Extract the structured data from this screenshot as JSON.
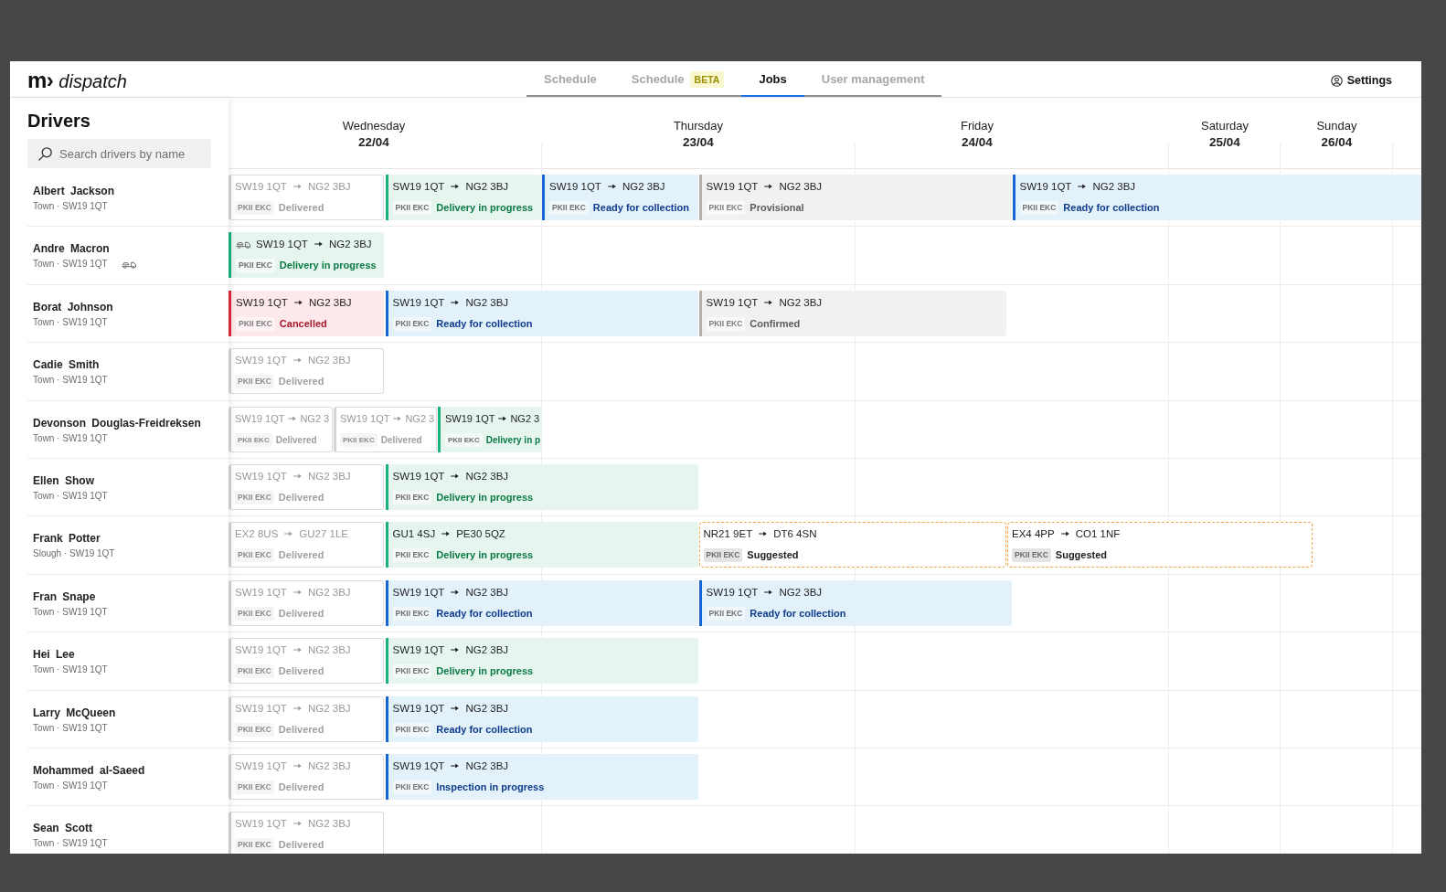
{
  "app": {
    "logo_mark": "m›",
    "logo_name": "dispatch"
  },
  "tabs": [
    {
      "label": "Schedule",
      "selected": false
    },
    {
      "label": "Schedule",
      "badge": "BETA",
      "selected": false
    },
    {
      "label": "Jobs",
      "selected": true
    },
    {
      "label": "User management",
      "selected": false
    }
  ],
  "settings": {
    "label": "Settings"
  },
  "sidebar": {
    "title": "Drivers",
    "search": {
      "placeholder": "Search drivers by name"
    }
  },
  "days": [
    {
      "name": "Wednesday",
      "date": "22/04"
    },
    {
      "name": "Thursday",
      "date": "23/04"
    },
    {
      "name": "Friday",
      "date": "24/04"
    },
    {
      "name": "Saturday",
      "date": "25/04"
    },
    {
      "name": "Sunday",
      "date": "26/04"
    }
  ],
  "drivers": [
    {
      "name": "Albert Jackson",
      "subtitle": "Town · SW19 1QT",
      "marker": false,
      "jobs": [
        {
          "from": "SW19 1QT",
          "to": "NG2 3BJ",
          "reg": "PKII EKC",
          "status": "Delivered",
          "kind": "delivered",
          "marker": false
        },
        {
          "from": "SW19 1QT",
          "to": "NG2 3BJ",
          "reg": "PKII EKC",
          "status": "Delivery in progress",
          "kind": "delivering",
          "marker": false
        },
        {
          "from": "SW19 1QT",
          "to": "NG2 3BJ",
          "reg": "PKII EKC",
          "status": "Ready for collection",
          "kind": "ready",
          "marker": false
        },
        {
          "from": "SW19 1QT",
          "to": "NG2 3BJ",
          "reg": "PKII EKC",
          "status": "Provisional",
          "kind": "provisional",
          "marker": false
        },
        {
          "from": "SW19 1QT",
          "to": "NG2 3BJ",
          "reg": "PKII EKC",
          "status": "Ready for collection",
          "kind": "ready",
          "marker": false
        }
      ]
    },
    {
      "name": "Andre Macron",
      "subtitle": "Town · SW19 1QT",
      "marker": true,
      "jobs": [
        {
          "from": "SW19 1QT",
          "to": "NG2 3BJ",
          "reg": "PKII EKC",
          "status": "Delivery in progress",
          "kind": "delivering",
          "marker": true
        }
      ]
    },
    {
      "name": "Borat Johnson",
      "subtitle": "Town · SW19 1QT",
      "marker": false,
      "jobs": [
        {
          "from": "SW19 1QT",
          "to": "NG2 3BJ",
          "reg": "PKII EKC",
          "status": "Cancelled",
          "kind": "cancelled",
          "marker": false
        },
        {
          "from": "SW19 1QT",
          "to": "NG2 3BJ",
          "reg": "PKII EKC",
          "status": "Ready for collection",
          "kind": "ready",
          "marker": false
        },
        {
          "from": "SW19 1QT",
          "to": "NG2 3BJ",
          "reg": "PKII EKC",
          "status": "Confirmed",
          "kind": "confirmed",
          "marker": false
        }
      ]
    },
    {
      "name": "Cadie Smith",
      "subtitle": "Town · SW19 1QT",
      "marker": false,
      "jobs": [
        {
          "from": "SW19 1QT",
          "to": "NG2 3BJ",
          "reg": "PKII EKC",
          "status": "Delivered",
          "kind": "delivered",
          "marker": false
        }
      ]
    },
    {
      "name": "Devonson Douglas-Freidreksen",
      "subtitle": "Town · SW19 1QT",
      "marker": false,
      "jobs": [
        {
          "from": "SW19 1QT",
          "to": "NG2 3",
          "reg": "PKII EKC",
          "status": "Delivered",
          "kind": "delivered",
          "marker": false
        },
        {
          "from": "SW19 1QT",
          "to": "NG2 3",
          "reg": "PKII EKC",
          "status": "Delivered",
          "kind": "delivered",
          "marker": false
        },
        {
          "from": "SW19 1QT",
          "to": "NG2 3",
          "reg": "PKII EKC",
          "status": "Delivery in p",
          "kind": "delivering",
          "marker": false
        }
      ]
    },
    {
      "name": "Ellen Show",
      "subtitle": "Town · SW19 1QT",
      "marker": false,
      "jobs": [
        {
          "from": "SW19 1QT",
          "to": "NG2 3BJ",
          "reg": "PKII EKC",
          "status": "Delivered",
          "kind": "delivered",
          "marker": false
        },
        {
          "from": "SW19 1QT",
          "to": "NG2 3BJ",
          "reg": "PKII EKC",
          "status": "Delivery in progress",
          "kind": "delivering",
          "marker": false
        }
      ]
    },
    {
      "name": "Frank Potter",
      "subtitle": "Slough · SW19 1QT",
      "marker": false,
      "jobs": [
        {
          "from": "EX2 8US",
          "to": "GU27 1LE",
          "reg": "PKII EKC",
          "status": "Delivered",
          "kind": "delivered",
          "marker": false
        },
        {
          "from": "GU1 4SJ",
          "to": "PE30 5QZ",
          "reg": "PKII EKC",
          "status": "Delivery in progress",
          "kind": "delivering",
          "marker": false
        },
        {
          "from": "NR21 9ET",
          "to": "DT6 4SN",
          "reg": "PKII EKC",
          "status": "Suggested",
          "kind": "suggested",
          "marker": false
        },
        {
          "from": "EX4 4PP",
          "to": "CO1 1NF",
          "reg": "PKII EKC",
          "status": "Suggested",
          "kind": "suggested",
          "marker": false
        }
      ]
    },
    {
      "name": "Fran Snape",
      "subtitle": "Town · SW19 1QT",
      "marker": false,
      "jobs": [
        {
          "from": "SW19 1QT",
          "to": "NG2 3BJ",
          "reg": "PKII EKC",
          "status": "Delivered",
          "kind": "delivered",
          "marker": false
        },
        {
          "from": "SW19 1QT",
          "to": "NG2 3BJ",
          "reg": "PKII EKC",
          "status": "Ready for collection",
          "kind": "ready",
          "marker": false
        },
        {
          "from": "SW19 1QT",
          "to": "NG2 3BJ",
          "reg": "PKII EKC",
          "status": "Ready for collection",
          "kind": "ready",
          "marker": false
        }
      ]
    },
    {
      "name": "Hei Lee",
      "subtitle": "Town · SW19 1QT",
      "marker": false,
      "jobs": [
        {
          "from": "SW19 1QT",
          "to": "NG2 3BJ",
          "reg": "PKII EKC",
          "status": "Delivered",
          "kind": "delivered",
          "marker": false
        },
        {
          "from": "SW19 1QT",
          "to": "NG2 3BJ",
          "reg": "PKII EKC",
          "status": "Delivery in progress",
          "kind": "delivering",
          "marker": false
        }
      ]
    },
    {
      "name": "Larry McQueen",
      "subtitle": "Town · SW19 1QT",
      "marker": false,
      "jobs": [
        {
          "from": "SW19 1QT",
          "to": "NG2 3BJ",
          "reg": "PKII EKC",
          "status": "Delivered",
          "kind": "delivered",
          "marker": false
        },
        {
          "from": "SW19 1QT",
          "to": "NG2 3BJ",
          "reg": "PKII EKC",
          "status": "Ready for collection",
          "kind": "ready",
          "marker": false
        }
      ]
    },
    {
      "name": "Mohammed al-Saeed",
      "subtitle": "Town · SW19 1QT",
      "marker": false,
      "jobs": [
        {
          "from": "SW19 1QT",
          "to": "NG2 3BJ",
          "reg": "PKII EKC",
          "status": "Delivered",
          "kind": "delivered",
          "marker": false
        },
        {
          "from": "SW19 1QT",
          "to": "NG2 3BJ",
          "reg": "PKII EKC",
          "status": "Inspection in progress",
          "kind": "inspecting",
          "marker": false
        }
      ]
    },
    {
      "name": "Sean Scott",
      "subtitle": "Town · SW19 1QT",
      "marker": false,
      "jobs": [
        {
          "from": "SW19 1QT",
          "to": "NG2 3BJ",
          "reg": "PKII EKC",
          "status": "Delivered",
          "kind": "delivered",
          "marker": false
        }
      ]
    }
  ]
}
